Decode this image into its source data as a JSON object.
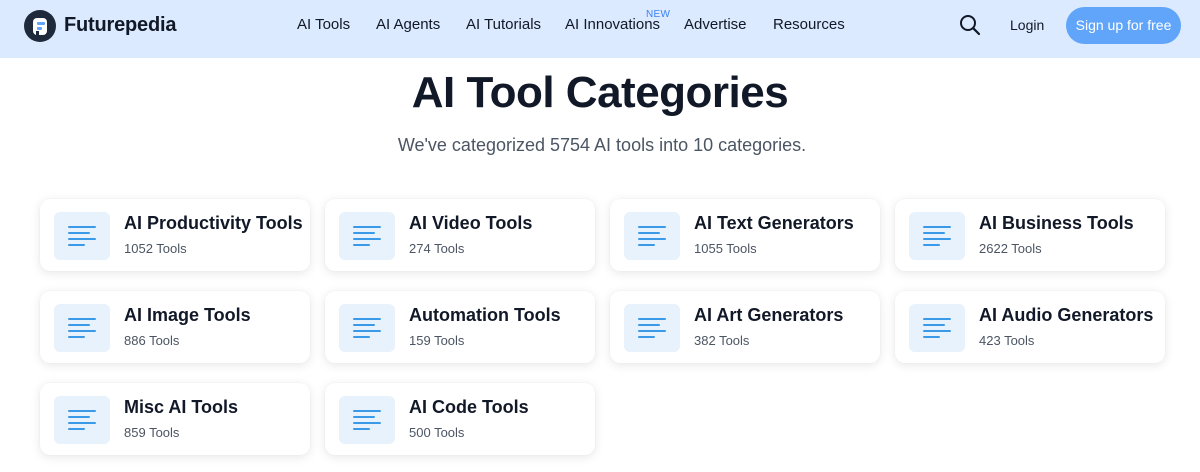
{
  "header": {
    "brand": "Futurepedia",
    "nav": [
      {
        "label": "AI Tools"
      },
      {
        "label": "AI Agents"
      },
      {
        "label": "AI Tutorials"
      },
      {
        "label": "AI Innovations",
        "badge": "NEW"
      },
      {
        "label": "Advertise"
      },
      {
        "label": "Resources"
      }
    ],
    "search_icon": "search-icon",
    "login_label": "Login",
    "signup_label": "Sign up for free"
  },
  "hero": {
    "title": "AI Tool Categories",
    "subtitle": "We've categorized 5754 AI tools into 10 categories."
  },
  "categories": [
    {
      "name": "AI Productivity Tools",
      "count": "1052 Tools",
      "icon": "document-lines-icon"
    },
    {
      "name": "AI Video Tools",
      "count": "274 Tools",
      "icon": "document-lines-icon"
    },
    {
      "name": "AI Text Generators",
      "count": "1055 Tools",
      "icon": "document-lines-icon"
    },
    {
      "name": "AI Business Tools",
      "count": "2622 Tools",
      "icon": "document-lines-icon"
    },
    {
      "name": "AI Image Tools",
      "count": "886 Tools",
      "icon": "document-lines-icon"
    },
    {
      "name": "Automation Tools",
      "count": "159 Tools",
      "icon": "document-lines-icon"
    },
    {
      "name": "AI Art Generators",
      "count": "382 Tools",
      "icon": "document-lines-icon"
    },
    {
      "name": "AI Audio Generators",
      "count": "423 Tools",
      "icon": "document-lines-icon"
    },
    {
      "name": "Misc AI Tools",
      "count": "859 Tools",
      "icon": "document-lines-icon"
    },
    {
      "name": "AI Code Tools",
      "count": "500 Tools",
      "icon": "document-lines-icon"
    }
  ],
  "colors": {
    "header_bg": "#dbeafe",
    "accent": "#60a5fa",
    "icon_tile_bg": "#e8f2fd",
    "icon_lines": "#3b9ae8",
    "badge": "#3b82f6"
  }
}
